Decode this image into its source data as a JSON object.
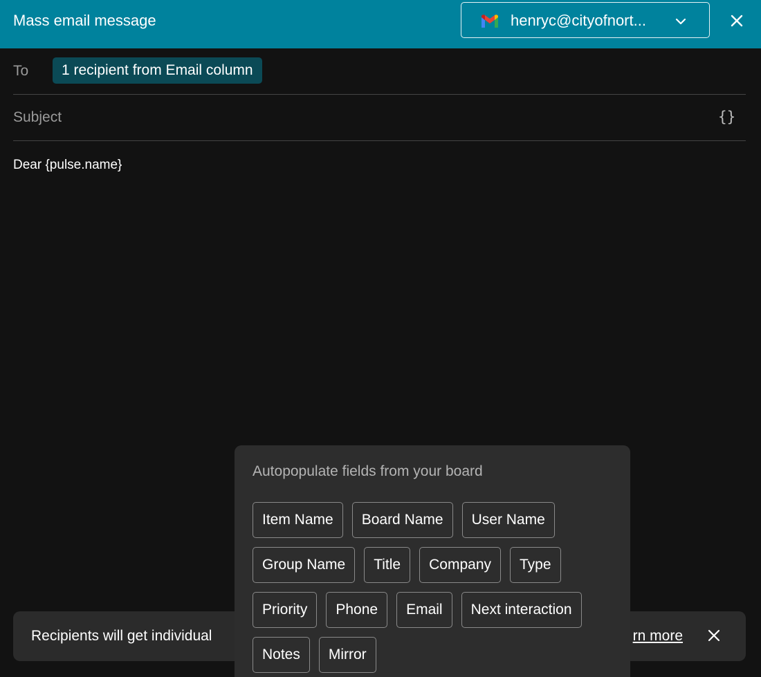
{
  "header": {
    "title": "Mass email message",
    "account_email": "henryc@cityofnort...",
    "account_icon": "gmail-icon",
    "dropdown_icon": "chevron-down-icon",
    "close_icon": "close-icon"
  },
  "to": {
    "label": "To",
    "recipient_chip": "1 recipient from Email column"
  },
  "subject": {
    "placeholder": "Subject",
    "variables_icon": "{}"
  },
  "body": {
    "text": "Dear {pulse.name}"
  },
  "toast": {
    "text": "Recipients will get individual",
    "link": "rn more",
    "close_icon": "close-icon"
  },
  "popover": {
    "title": "Autopopulate fields from your board",
    "fields": [
      "Item Name",
      "Board Name",
      "User Name",
      "Group Name",
      "Title",
      "Company",
      "Type",
      "Priority",
      "Phone",
      "Email",
      "Next interaction",
      "Notes",
      "Mirror"
    ]
  },
  "colors": {
    "header_bg": "#00829d",
    "page_bg": "#121212",
    "chip_bg": "#0b4a56",
    "popover_bg": "#2d2d2d",
    "toast_bg": "#2b2b2b"
  }
}
